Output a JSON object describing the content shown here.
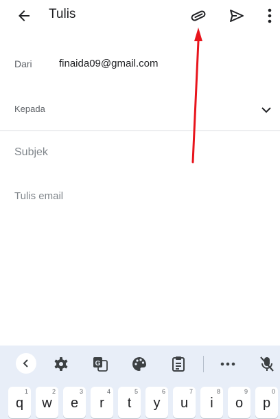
{
  "appbar": {
    "title": "Tulis",
    "icons": {
      "back": "arrow-back-icon",
      "attach": "paperclip-icon",
      "send": "send-icon",
      "more": "more-vert-icon"
    }
  },
  "compose": {
    "from_label": "Dari",
    "from_value": "finaida09@gmail.com",
    "to_label": "Kepada",
    "subject_placeholder": "Subjek",
    "body_placeholder": "Tulis email"
  },
  "annotation": {
    "color": "#e8141c"
  },
  "keyboard": {
    "toolbar": [
      "chevron-left-icon",
      "gear-icon",
      "translate-icon",
      "palette-icon",
      "clipboard-icon",
      "more-horiz-icon",
      "mic-off-icon"
    ],
    "keys": [
      {
        "char": "q",
        "hint": "1"
      },
      {
        "char": "w",
        "hint": "2"
      },
      {
        "char": "e",
        "hint": "3"
      },
      {
        "char": "r",
        "hint": "4"
      },
      {
        "char": "t",
        "hint": "5"
      },
      {
        "char": "y",
        "hint": "6"
      },
      {
        "char": "u",
        "hint": "7"
      },
      {
        "char": "i",
        "hint": "8"
      },
      {
        "char": "o",
        "hint": "9"
      },
      {
        "char": "p",
        "hint": "0"
      }
    ]
  }
}
